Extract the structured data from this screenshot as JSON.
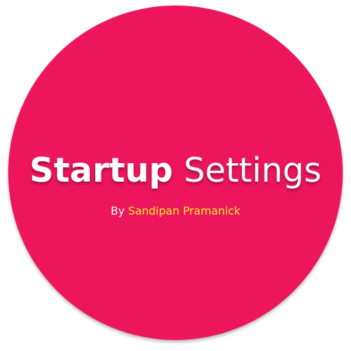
{
  "logo": {
    "title_bold": "Startup",
    "title_regular": "Settings",
    "by_prefix": "By",
    "author": "Sandipan Pramanick"
  },
  "colors": {
    "badge": "#ed165c",
    "title": "#ffffff",
    "by_prefix": "#ffffff",
    "author": "#f7f22b"
  }
}
